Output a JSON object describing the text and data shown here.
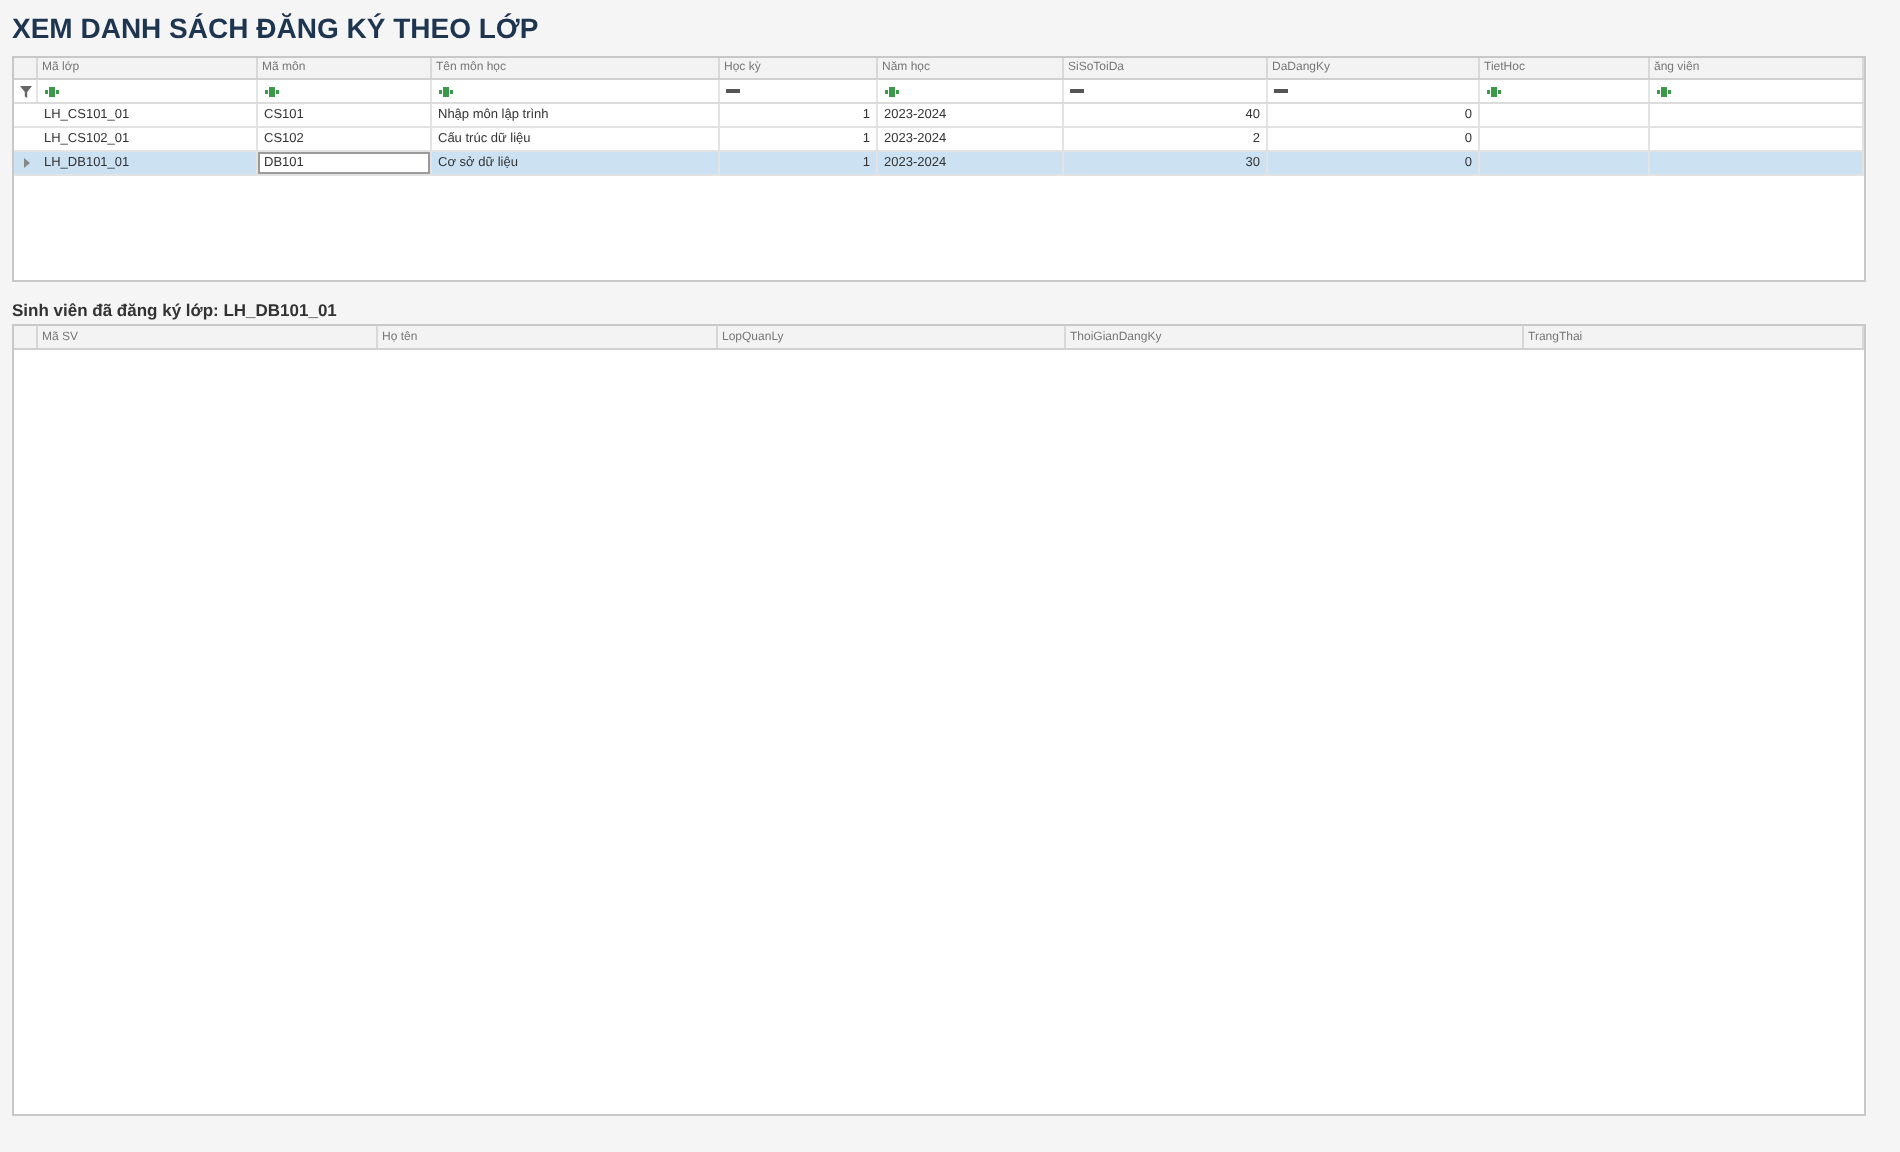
{
  "title": "XEM DANH SÁCH ĐĂNG KÝ THEO LỚP",
  "class_grid": {
    "columns": [
      {
        "label": "Mã lớp",
        "kind": "text"
      },
      {
        "label": "Mã môn",
        "kind": "text"
      },
      {
        "label": "Tên môn học",
        "kind": "text"
      },
      {
        "label": "Học kỳ",
        "kind": "number"
      },
      {
        "label": "Năm học",
        "kind": "text"
      },
      {
        "label": "SiSoToiDa",
        "kind": "number"
      },
      {
        "label": "DaDangKy",
        "kind": "number"
      },
      {
        "label": "TietHoc",
        "kind": "text"
      },
      {
        "label": "ăng viên",
        "kind": "text"
      }
    ],
    "rows": [
      {
        "selected": false,
        "cells": [
          {
            "text": "LH_CS101_01",
            "editing": false
          },
          {
            "text": "CS101",
            "editing": false
          },
          {
            "text": "Nhập môn lập trình",
            "editing": false
          },
          {
            "text": "1",
            "editing": false
          },
          {
            "text": "2023-2024",
            "editing": false
          },
          {
            "text": "40",
            "editing": false
          },
          {
            "text": "0",
            "editing": false
          }
        ]
      },
      {
        "selected": false,
        "cells": [
          {
            "text": "LH_CS102_01",
            "editing": false
          },
          {
            "text": "CS102",
            "editing": false
          },
          {
            "text": "Cấu trúc dữ liệu",
            "editing": false
          },
          {
            "text": "1",
            "editing": false
          },
          {
            "text": "2023-2024",
            "editing": false
          },
          {
            "text": "2",
            "editing": false
          },
          {
            "text": "0",
            "editing": false
          }
        ]
      },
      {
        "selected": true,
        "cells": [
          {
            "text": "LH_DB101_01",
            "editing": false
          },
          {
            "text": "DB101",
            "editing": true
          },
          {
            "text": "Cơ sở dữ liệu",
            "editing": false
          },
          {
            "text": "1",
            "editing": false
          },
          {
            "text": "2023-2024",
            "editing": false
          },
          {
            "text": "30",
            "editing": false
          },
          {
            "text": "0",
            "editing": false
          }
        ]
      }
    ]
  },
  "students_label": "Sinh viên đã đăng ký lớp: LH_DB101_01",
  "student_grid": {
    "columns": [
      {
        "label": "Mã SV"
      },
      {
        "label": "Họ tên"
      },
      {
        "label": "LopQuanLy"
      },
      {
        "label": "ThoiGianDangKy"
      },
      {
        "label": "TrangThai"
      }
    ]
  }
}
